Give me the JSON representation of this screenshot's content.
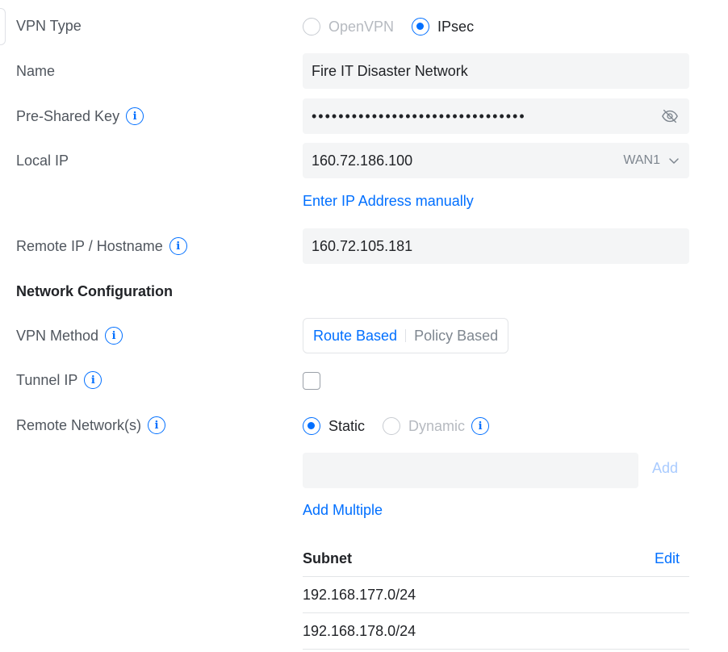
{
  "form": {
    "vpn_type": {
      "label": "VPN Type",
      "options": [
        {
          "label": "OpenVPN",
          "selected": false
        },
        {
          "label": "IPsec",
          "selected": true
        }
      ]
    },
    "name": {
      "label": "Name",
      "value": "Fire IT Disaster Network"
    },
    "pre_shared_key": {
      "label": "Pre-Shared Key",
      "masked_value": "••••••••••••••••••••••••••••••••",
      "icon": "eye-off-icon"
    },
    "local_ip": {
      "label": "Local IP",
      "value": "160.72.186.100",
      "interface": "WAN1",
      "manual_link": "Enter IP Address manually"
    },
    "remote_ip": {
      "label": "Remote IP / Hostname",
      "value": "160.72.105.181"
    },
    "network_configuration": {
      "title": "Network Configuration"
    },
    "vpn_method": {
      "label": "VPN Method",
      "options": [
        {
          "label": "Route Based",
          "selected": true
        },
        {
          "label": "Policy Based",
          "selected": false
        }
      ]
    },
    "tunnel_ip": {
      "label": "Tunnel IP",
      "checked": false
    },
    "remote_networks": {
      "label": "Remote Network(s)",
      "options": [
        {
          "label": "Static",
          "selected": true
        },
        {
          "label": "Dynamic",
          "selected": false
        }
      ],
      "input_value": "",
      "add_label": "Add",
      "add_multiple_label": "Add Multiple",
      "table": {
        "header": "Subnet",
        "edit_label": "Edit",
        "rows": [
          "192.168.177.0/24",
          "192.168.178.0/24"
        ]
      }
    }
  },
  "colors": {
    "accent": "#006fff",
    "label": "#50565e",
    "field_bg": "#f4f5f6",
    "disabled": "#b6bac0"
  }
}
